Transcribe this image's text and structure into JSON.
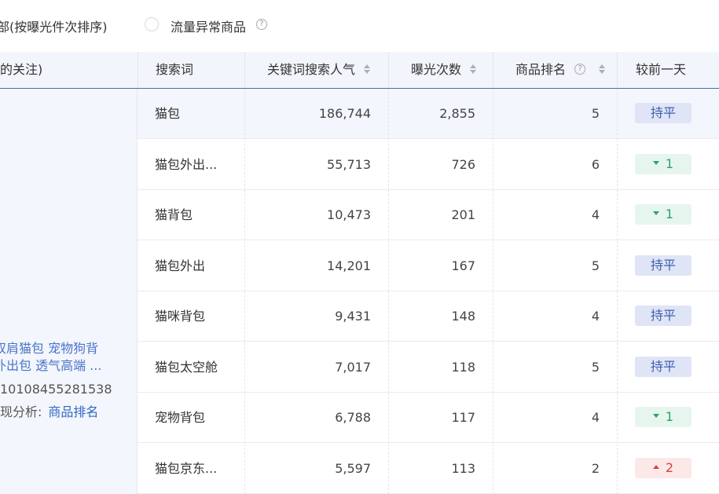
{
  "filter": {
    "left_label": "部(按曝光件次排序)",
    "right_label": "流量异常商品",
    "help_glyph": "?"
  },
  "table": {
    "headers": {
      "product": "的关注)",
      "keyword": "搜索词",
      "popularity": "关键词搜索人气",
      "exposure": "曝光次数",
      "rank": "商品排名",
      "change": "较前一天",
      "help_glyph": "?"
    },
    "product": {
      "title_line1": "双肩猫包 宠物狗背",
      "title_line2": "外出包 透气高端 ...",
      "id": "10108455281538",
      "analysis_label": "现分析:",
      "analysis_link": "商品排名"
    },
    "rows": [
      {
        "keyword": "猫包",
        "popularity": "186,744",
        "exposure": "2,855",
        "rank": "5",
        "change_type": "flat",
        "change_text": "持平"
      },
      {
        "keyword": "猫包外出...",
        "popularity": "55,713",
        "exposure": "726",
        "rank": "6",
        "change_type": "down",
        "change_text": "1"
      },
      {
        "keyword": "猫背包",
        "popularity": "10,473",
        "exposure": "201",
        "rank": "4",
        "change_type": "down",
        "change_text": "1"
      },
      {
        "keyword": "猫包外出",
        "popularity": "14,201",
        "exposure": "167",
        "rank": "5",
        "change_type": "flat",
        "change_text": "持平"
      },
      {
        "keyword": "猫咪背包",
        "popularity": "9,431",
        "exposure": "148",
        "rank": "4",
        "change_type": "flat",
        "change_text": "持平"
      },
      {
        "keyword": "猫包太空舱",
        "popularity": "7,017",
        "exposure": "118",
        "rank": "5",
        "change_type": "flat",
        "change_text": "持平"
      },
      {
        "keyword": "宠物背包",
        "popularity": "6,788",
        "exposure": "117",
        "rank": "4",
        "change_type": "down",
        "change_text": "1"
      },
      {
        "keyword": "猫包京东...",
        "popularity": "5,597",
        "exposure": "113",
        "rank": "2",
        "change_type": "up",
        "change_text": "2"
      }
    ]
  },
  "colors": {
    "link": "#2f66c3",
    "badge_flat": "#dfe5f6",
    "badge_down": "#e6f6ef",
    "badge_up": "#fde8e8"
  }
}
